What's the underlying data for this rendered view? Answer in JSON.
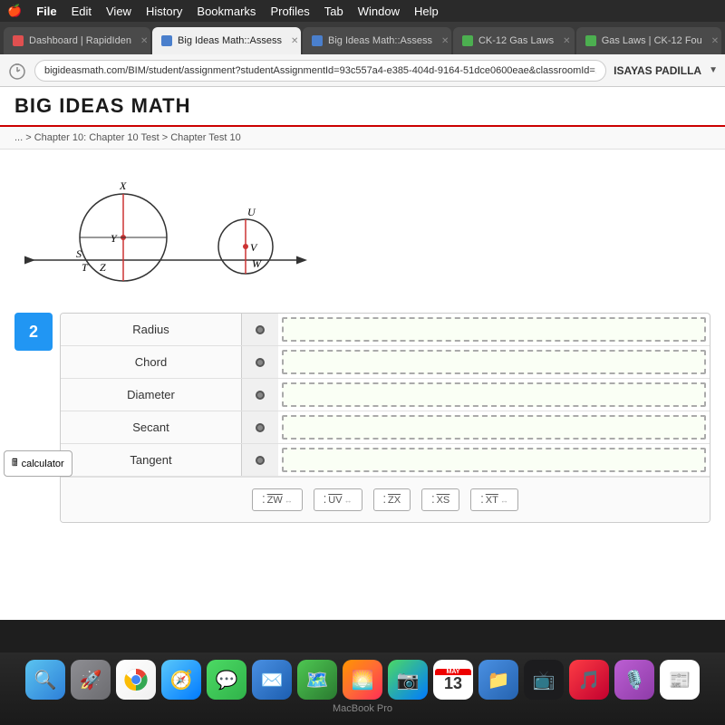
{
  "menubar": {
    "items": [
      "",
      "Edit",
      "View",
      "History",
      "Bookmarks",
      "Profiles",
      "Tab",
      "Window",
      "Help"
    ],
    "apple": "🍎"
  },
  "tabs": [
    {
      "label": "Dashboard | RapidIden",
      "active": false,
      "icon": "red",
      "id": "tab-dashboard"
    },
    {
      "label": "Big Ideas Math::Assess",
      "active": true,
      "icon": "blue",
      "id": "tab-bigideas1"
    },
    {
      "label": "Big Ideas Math::Assess",
      "active": false,
      "icon": "blue",
      "id": "tab-bigideas2"
    },
    {
      "label": "CK-12 Gas Laws",
      "active": false,
      "icon": "green",
      "id": "tab-ck12"
    },
    {
      "label": "Gas Laws | CK-12 Fou",
      "active": false,
      "icon": "green",
      "id": "tab-gaslaws"
    }
  ],
  "addressbar": {
    "url": "bigideasmath.com/BIM/student/assignment?studentAssignmentId=93c557a4-e385-404d-9164-51dce0600eae&classroomId=...",
    "user": "ISAYAS PADILLA"
  },
  "header": {
    "title": "BIG IDEAS MATH"
  },
  "breadcrumb": "... > Chapter 10: Chapter 10 Test > Chapter Test 10",
  "question": {
    "number": "2",
    "terms": [
      {
        "label": "Radius",
        "id": "term-radius"
      },
      {
        "label": "Chord",
        "id": "term-chord"
      },
      {
        "label": "Diameter",
        "id": "term-diameter"
      },
      {
        "label": "Secant",
        "id": "term-secant"
      },
      {
        "label": "Tangent",
        "id": "term-tangent"
      }
    ],
    "answer_bank": [
      {
        "label": "ZW",
        "arrows": "double",
        "id": "ans-zw"
      },
      {
        "label": "UV",
        "arrows": "double",
        "id": "ans-uv"
      },
      {
        "label": "ZX",
        "arrows": "single_right",
        "id": "ans-zx"
      },
      {
        "label": "XS",
        "arrows": "overline",
        "id": "ans-xs"
      },
      {
        "label": "XT",
        "arrows": "double",
        "id": "ans-xt"
      }
    ]
  },
  "calculator": {
    "label": "calculator"
  },
  "dock": {
    "apps": [
      {
        "name": "Finder",
        "emoji": "🔍",
        "class": "finder",
        "id": "dock-finder"
      },
      {
        "name": "Launchpad",
        "emoji": "🚀",
        "class": "launchpad",
        "id": "dock-launchpad"
      },
      {
        "name": "Chrome",
        "emoji": "🌐",
        "class": "chrome",
        "id": "dock-chrome"
      },
      {
        "name": "Safari",
        "emoji": "🧭",
        "class": "safari",
        "id": "dock-safari"
      },
      {
        "name": "Messages",
        "emoji": "💬",
        "class": "messages",
        "id": "dock-messages"
      },
      {
        "name": "Mail",
        "emoji": "✉️",
        "class": "mail",
        "id": "dock-mail"
      },
      {
        "name": "Maps",
        "emoji": "🗺",
        "class": "maps",
        "id": "dock-maps"
      },
      {
        "name": "Photos",
        "emoji": "🌅",
        "class": "photos",
        "id": "dock-photos"
      },
      {
        "name": "FaceTime",
        "emoji": "📷",
        "class": "facetime",
        "id": "dock-facetime"
      },
      {
        "name": "13",
        "emoji": "13",
        "class": "calendar",
        "id": "dock-calendar"
      },
      {
        "name": "Files",
        "emoji": "📁",
        "class": "files",
        "id": "dock-files"
      },
      {
        "name": "Apple TV",
        "emoji": "📺",
        "class": "appletv",
        "id": "dock-tv"
      },
      {
        "name": "Music",
        "emoji": "🎵",
        "class": "music",
        "id": "dock-music"
      },
      {
        "name": "Podcasts",
        "emoji": "🎙",
        "class": "podcasts",
        "id": "dock-podcasts"
      },
      {
        "name": "News",
        "emoji": "📰",
        "class": "news",
        "id": "dock-news"
      }
    ],
    "macbook_label": "MacBook Pro"
  }
}
